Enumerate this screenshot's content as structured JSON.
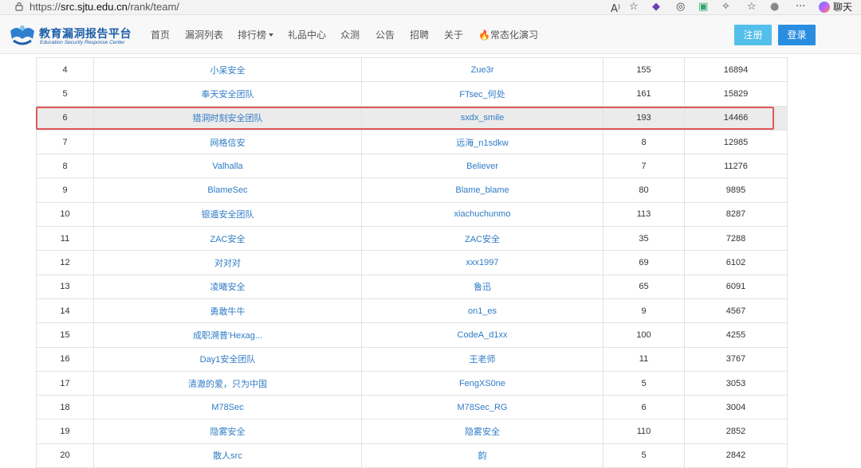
{
  "browser": {
    "url_prefix": "https://",
    "url_host": "src.sjtu.edu.cn",
    "url_path": "/rank/team/",
    "chat_label": "聊天"
  },
  "site": {
    "brand_title": "教育漏洞报告平台",
    "brand_subtitle": "Education Security Response Center",
    "nav": [
      "首页",
      "漏洞列表",
      "排行榜",
      "礼品中心",
      "众测",
      "公告",
      "招聘",
      "关于",
      "常态化演习"
    ],
    "register_label": "注册",
    "login_label": "登录"
  },
  "table": {
    "highlight_rank": "6",
    "rows": [
      {
        "rank": "4",
        "team": "小呆安全",
        "leader": "Zue3r",
        "count": "155",
        "score": "16894"
      },
      {
        "rank": "5",
        "team": "奉天安全团队",
        "leader": "FTsec_何处",
        "count": "161",
        "score": "15829"
      },
      {
        "rank": "6",
        "team": "猎洞时刻安全团队",
        "leader": "sxdx_smile",
        "count": "193",
        "score": "14466"
      },
      {
        "rank": "7",
        "team": "网格信安",
        "leader": "远海_n1sdkw",
        "count": "8",
        "score": "12985"
      },
      {
        "rank": "8",
        "team": "Valhalla",
        "leader": "Believer",
        "count": "7",
        "score": "11276"
      },
      {
        "rank": "9",
        "team": "BlameSec",
        "leader": "Blame_blame",
        "count": "80",
        "score": "9895"
      },
      {
        "rank": "10",
        "team": "银遁安全团队",
        "leader": "xiachuchunmo",
        "count": "113",
        "score": "8287"
      },
      {
        "rank": "11",
        "team": "ZAC安全",
        "leader": "ZAC安全",
        "count": "35",
        "score": "7288"
      },
      {
        "rank": "12",
        "team": "对对对",
        "leader": "xxx1997",
        "count": "69",
        "score": "6102"
      },
      {
        "rank": "13",
        "team": "凌曦安全",
        "leader": "鲁迅",
        "count": "65",
        "score": "6091"
      },
      {
        "rank": "14",
        "team": "勇敢牛牛",
        "leader": "on1_es",
        "count": "9",
        "score": "4567"
      },
      {
        "rank": "15",
        "team": "成职溯普'Hexag...",
        "leader": "CodeA_d1xx",
        "count": "100",
        "score": "4255"
      },
      {
        "rank": "16",
        "team": "Day1安全团队",
        "leader": "王老师",
        "count": "11",
        "score": "3767"
      },
      {
        "rank": "17",
        "team": "清澈的爱，只为中国",
        "leader": "FengXS0ne",
        "count": "5",
        "score": "3053"
      },
      {
        "rank": "18",
        "team": "M78Sec",
        "leader": "M78Sec_RG",
        "count": "6",
        "score": "3004"
      },
      {
        "rank": "19",
        "team": "隐雾安全",
        "leader": "隐雾安全",
        "count": "110",
        "score": "2852"
      },
      {
        "rank": "20",
        "team": "散人src",
        "leader": "韵",
        "count": "5",
        "score": "2842"
      }
    ]
  }
}
